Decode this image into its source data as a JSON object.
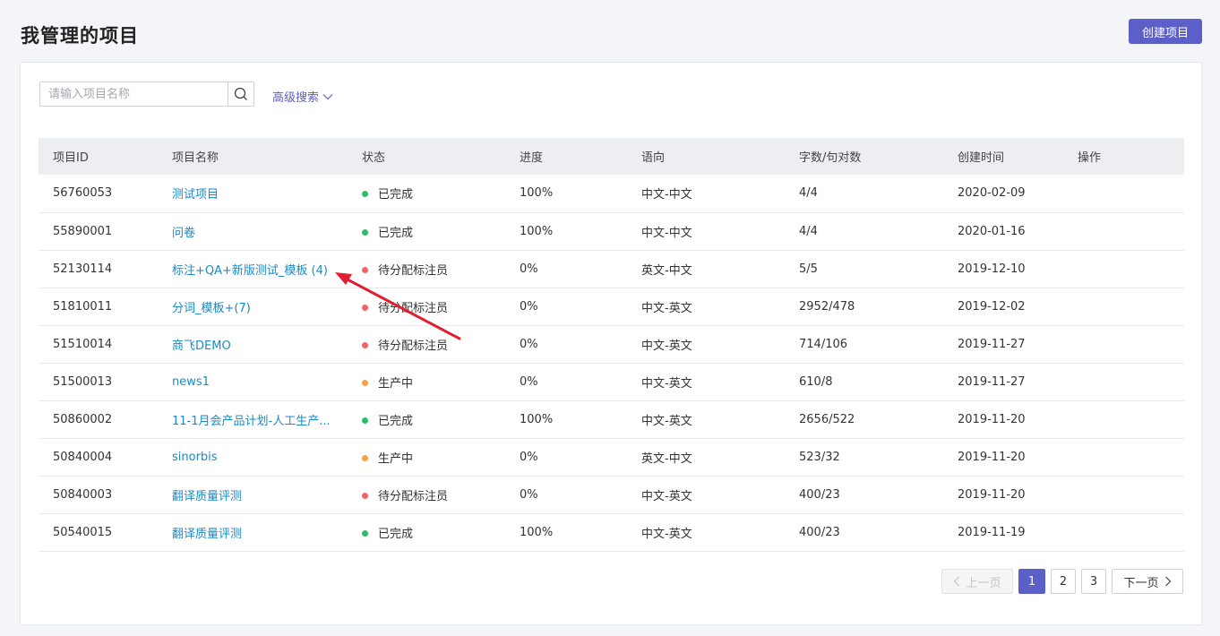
{
  "page": {
    "title": "我管理的项目",
    "create_button": "创建项目"
  },
  "search": {
    "placeholder": "请输入项目名称",
    "advanced_label": "高级搜索"
  },
  "table": {
    "headers": [
      "项目ID",
      "项目名称",
      "状态",
      "进度",
      "语向",
      "字数/句对数",
      "创建时间",
      "操作"
    ],
    "rows": [
      {
        "id": "56760053",
        "name": "测试项目",
        "status": "已完成",
        "status_color": "#2ebc6a",
        "progress": "100%",
        "direction": "中文-中文",
        "count": "4/4",
        "created": "2020-02-09"
      },
      {
        "id": "55890001",
        "name": "问卷",
        "status": "已完成",
        "status_color": "#2ebc6a",
        "progress": "100%",
        "direction": "中文-中文",
        "count": "4/4",
        "created": "2020-01-16"
      },
      {
        "id": "52130114",
        "name": "标注+QA+新版测试_模板 (4)",
        "status": "待分配标注员",
        "status_color": "#f06464",
        "progress": "0%",
        "direction": "英文-中文",
        "count": "5/5",
        "created": "2019-12-10"
      },
      {
        "id": "51810011",
        "name": "分词_模板+(7)",
        "status": "待分配标注员",
        "status_color": "#f06464",
        "progress": "0%",
        "direction": "中文-英文",
        "count": "2952/478",
        "created": "2019-12-02"
      },
      {
        "id": "51510014",
        "name": "商飞DEMO",
        "status": "待分配标注员",
        "status_color": "#f06464",
        "progress": "0%",
        "direction": "中文-英文",
        "count": "714/106",
        "created": "2019-11-27"
      },
      {
        "id": "51500013",
        "name": "news1",
        "status": "生产中",
        "status_color": "#f7a04a",
        "progress": "0%",
        "direction": "中文-英文",
        "count": "610/8",
        "created": "2019-11-27"
      },
      {
        "id": "50860002",
        "name": "11-1月会产品计划-人工生产...",
        "status": "已完成",
        "status_color": "#2ebc6a",
        "progress": "100%",
        "direction": "中文-英文",
        "count": "2656/522",
        "created": "2019-11-20"
      },
      {
        "id": "50840004",
        "name": "sinorbis",
        "status": "生产中",
        "status_color": "#f7a04a",
        "progress": "0%",
        "direction": "英文-中文",
        "count": "523/32",
        "created": "2019-11-20"
      },
      {
        "id": "50840003",
        "name": "翻译质量评测",
        "status": "待分配标注员",
        "status_color": "#f06464",
        "progress": "0%",
        "direction": "中文-英文",
        "count": "400/23",
        "created": "2019-11-20"
      },
      {
        "id": "50540015",
        "name": "翻译质量评测",
        "status": "已完成",
        "status_color": "#2ebc6a",
        "progress": "100%",
        "direction": "中文-英文",
        "count": "400/23",
        "created": "2019-11-19"
      }
    ]
  },
  "pagination": {
    "prev": "上一页",
    "pages": [
      "1",
      "2",
      "3"
    ],
    "current": "1",
    "next": "下一页"
  },
  "colors": {
    "accent": "#5b5fc7",
    "link": "#1a8bc6",
    "annotation_arrow": "#e02030"
  }
}
